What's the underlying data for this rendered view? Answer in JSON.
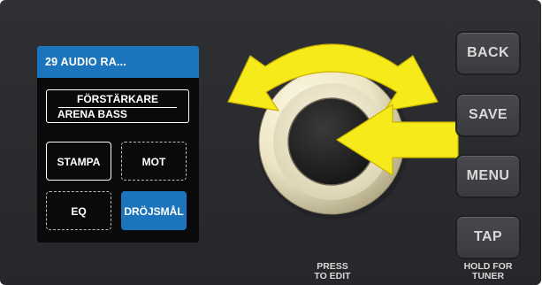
{
  "lcd": {
    "header": "29 AUDIO RA...",
    "preset_category": "FÖRSTÄRKARE",
    "preset_name": "ARENA BASS",
    "buttons": {
      "stampa": "STAMPA",
      "mot": "MOT",
      "eq": "EQ",
      "drojsmal": "DRÖJSMÅL"
    }
  },
  "hardware": {
    "back": "BACK",
    "save": "SAVE",
    "menu": "MENU",
    "tap": "TAP",
    "press_to_edit_1": "PRESS",
    "press_to_edit_2": "TO EDIT",
    "hold_for_tuner_1": "HOLD FOR",
    "hold_for_tuner_2": "TUNER"
  },
  "colors": {
    "panel": "#2b2c2f",
    "lcd_accent": "#1c75bc",
    "arrow_fill": "#f7ea1a"
  }
}
